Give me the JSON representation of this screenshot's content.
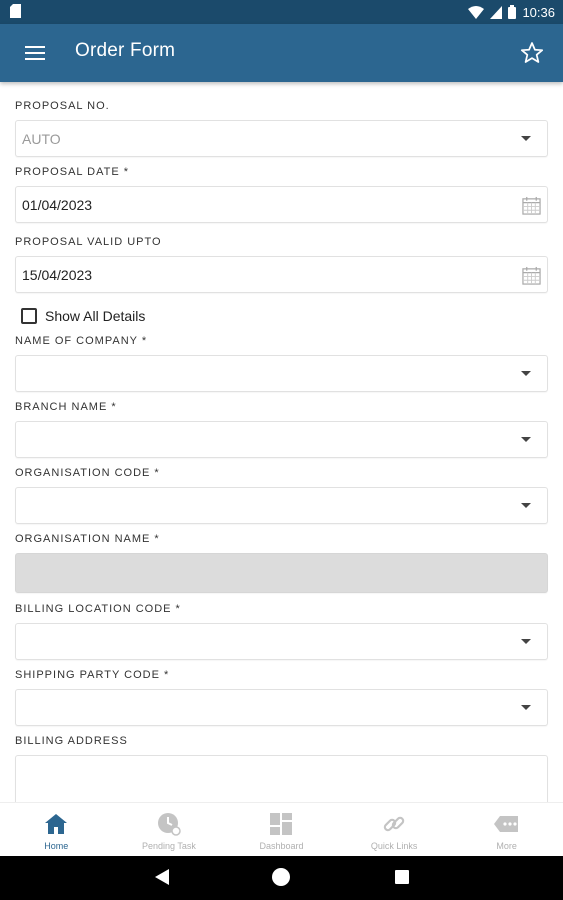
{
  "status_bar": {
    "time": "10:36"
  },
  "app_bar": {
    "title": "Order Form",
    "menu_icon": "hamburger-menu-icon",
    "action_icon": "star-outline-icon"
  },
  "form": {
    "proposal_no": {
      "label": "PROPOSAL NO.",
      "value": "AUTO"
    },
    "proposal_date": {
      "label": "PROPOSAL DATE *",
      "value": "01/04/2023"
    },
    "proposal_valid_upto": {
      "label": "PROPOSAL VALID UPTO",
      "value": "15/04/2023"
    },
    "show_all_details": {
      "label": "Show All Details",
      "checked": false
    },
    "name_of_company": {
      "label": "NAME OF COMPANY *",
      "value": ""
    },
    "branch_name": {
      "label": "BRANCH NAME *",
      "value": ""
    },
    "organisation_code": {
      "label": "ORGANISATION CODE *",
      "value": ""
    },
    "organisation_name": {
      "label": "ORGANISATION NAME *",
      "value": ""
    },
    "billing_location_code": {
      "label": "BILLING LOCATION CODE *",
      "value": ""
    },
    "shipping_party_code": {
      "label": "SHIPPING PARTY CODE *",
      "value": ""
    },
    "billing_address": {
      "label": "BILLING ADDRESS",
      "value": ""
    }
  },
  "bottom_nav": {
    "items": [
      {
        "label": "Home",
        "icon": "home-icon",
        "active": true
      },
      {
        "label": "Pending Task",
        "icon": "clock-icon",
        "active": false
      },
      {
        "label": "Dashboard",
        "icon": "dashboard-icon",
        "active": false
      },
      {
        "label": "Quick Links",
        "icon": "link-icon",
        "active": false
      },
      {
        "label": "More",
        "icon": "more-icon",
        "active": false
      }
    ]
  },
  "colors": {
    "app_bar": "#2c6690",
    "status_bar": "#1b4a6b",
    "active_nav": "#2c6690",
    "inactive_nav": "#b0b0b0",
    "disabled_field": "#dcdcdc"
  }
}
